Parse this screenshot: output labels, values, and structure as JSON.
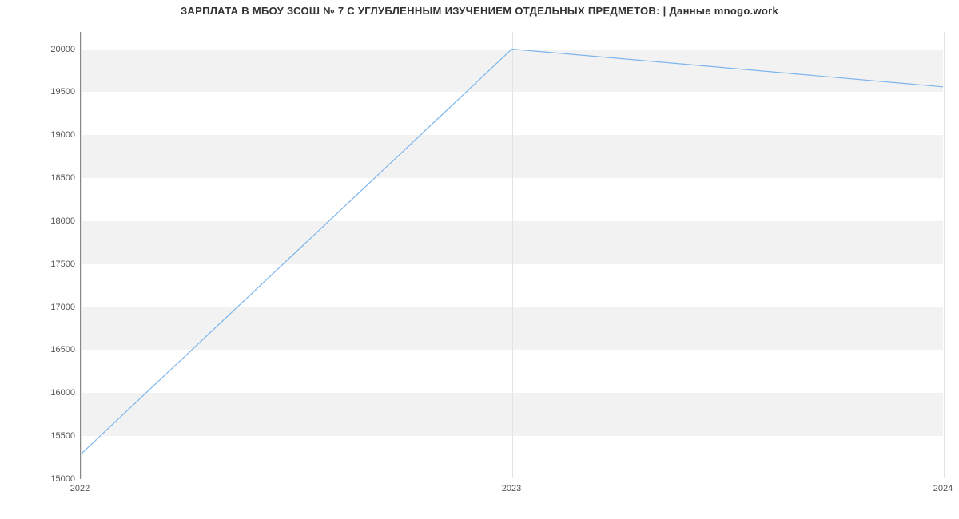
{
  "chart_data": {
    "type": "line",
    "title": "ЗАРПЛАТА В МБОУ ЗСОШ № 7 С УГЛУБЛЕННЫМ ИЗУЧЕНИЕМ ОТДЕЛЬНЫХ ПРЕДМЕТОВ: | Данные mnogo.work",
    "x": [
      2022,
      2023,
      2024
    ],
    "values": [
      15280,
      20000,
      19560
    ],
    "xlabel": "",
    "ylabel": "",
    "y_ticks": [
      15000,
      15500,
      16000,
      16500,
      17000,
      17500,
      18000,
      18500,
      19000,
      19500,
      20000
    ],
    "x_ticks": [
      2022,
      2023,
      2024
    ],
    "ylim": [
      15000,
      20200
    ],
    "xlim": [
      2022,
      2024
    ],
    "line_color": "#7cb5ec"
  }
}
